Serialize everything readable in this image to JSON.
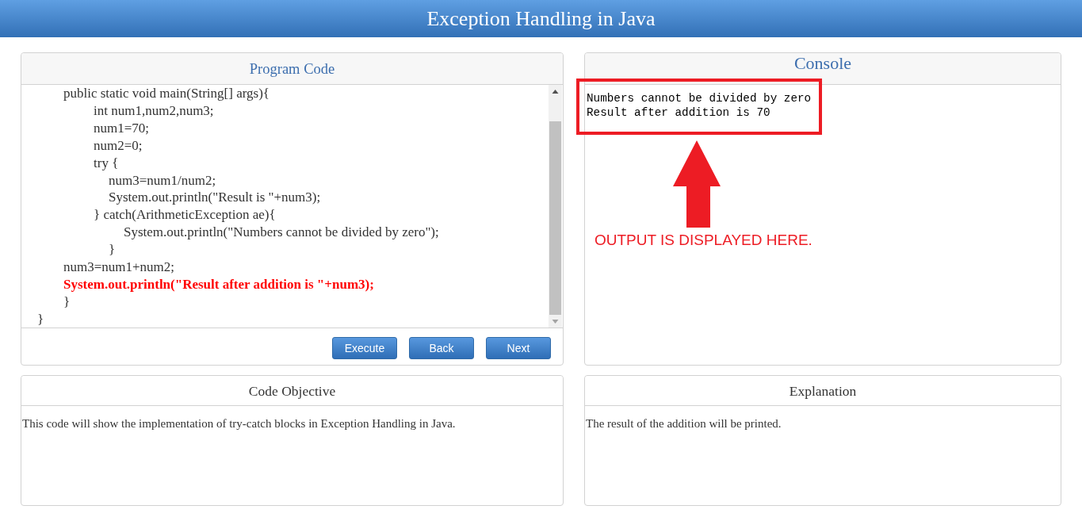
{
  "header": {
    "title": "Exception Handling in Java"
  },
  "program_code": {
    "title": "Program Code",
    "lines": [
      {
        "children": [
          {
            "text": "public static void main(String[] args){",
            "current": false,
            "children": [
              {
                "text": "int num1,num2,num3;",
                "current": false
              },
              {
                "text": "num1=70;",
                "current": false
              },
              {
                "text": "num2=0;",
                "current": false
              },
              {
                "text": "try {",
                "current": false,
                "children": [
                  {
                    "text": "num3=num1/num2;",
                    "current": false
                  },
                  {
                    "text": "System.out.println(\"Result is \"+num3);",
                    "current": false
                  }
                ]
              },
              {
                "text": "} catch(ArithmeticException ae){",
                "current": false,
                "children": [
                  {
                    "children": [
                      {
                        "text": "System.out.println(\"Numbers cannot be divided by zero\");",
                        "current": false
                      }
                    ]
                  },
                  {
                    "text": "}",
                    "current": false
                  }
                ]
              }
            ]
          },
          {
            "text": "num3=num1+num2;",
            "current": false
          },
          {
            "text": "System.out.println(\"Result after addition is \"+num3);",
            "current": true
          },
          {
            "text": "}",
            "current": false
          }
        ]
      },
      {
        "text": "}",
        "current": false
      }
    ],
    "buttons": [
      {
        "label": "Execute"
      },
      {
        "label": "Back"
      },
      {
        "label": "Next"
      }
    ]
  },
  "console": {
    "title": "Console",
    "output": [
      "Numbers cannot be divided by zero",
      "Result after addition is 70"
    ],
    "annotation": {
      "text": "OUTPUT IS DISPLAYED HERE."
    }
  },
  "code_objective": {
    "title": "Code Objective",
    "text": "This code will show the implementation of try-catch blocks in Exception Handling in Java."
  },
  "explanation": {
    "title": "Explanation",
    "text": "The result of the addition will be printed."
  }
}
